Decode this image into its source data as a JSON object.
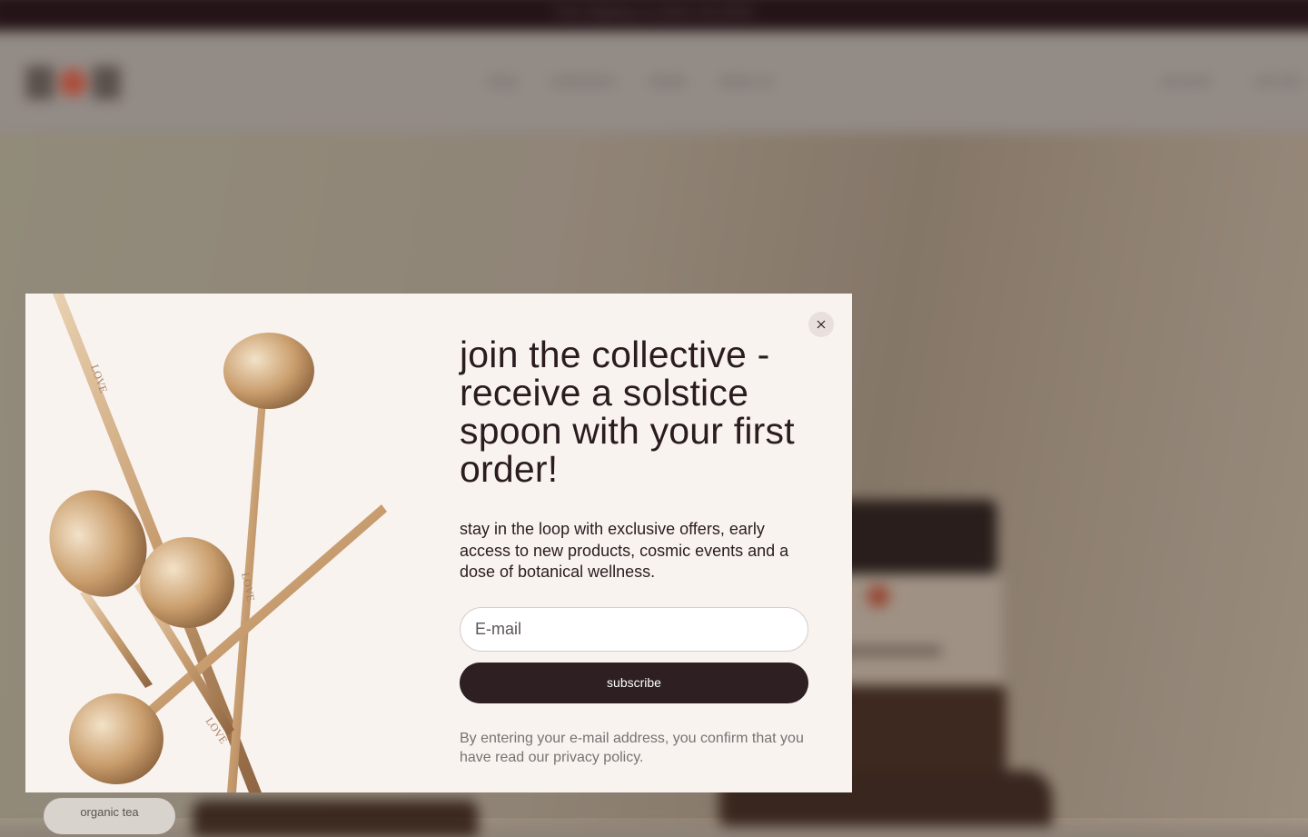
{
  "announcement": {
    "text": "Free shipping on orders over $100"
  },
  "header": {
    "logo_alt": "LOVE",
    "nav": [
      "shop",
      "collections",
      "rituals",
      "about us"
    ],
    "right": [
      "account",
      "cart (0)"
    ]
  },
  "hero": {
    "tag": "organic tea"
  },
  "popup": {
    "headline": "join the collective - receive a solstice spoon with your first order!",
    "subtext": "stay in the loop with exclusive offers, early access to new products, cosmic events and a dose of botanical wellness.",
    "email_placeholder": "E-mail",
    "subscribe_label": "subscribe",
    "disclaimer": "By entering your e-mail address, you confirm that you have read our privacy policy.",
    "image_alt": "solstice spoons",
    "engraving": "LOVE",
    "close_icon": "close-icon"
  },
  "colors": {
    "brand_dark": "#2d1f22",
    "modal_bg": "#f9f3f0",
    "announcement_bg": "#241317",
    "gold": "#c9a57c"
  }
}
